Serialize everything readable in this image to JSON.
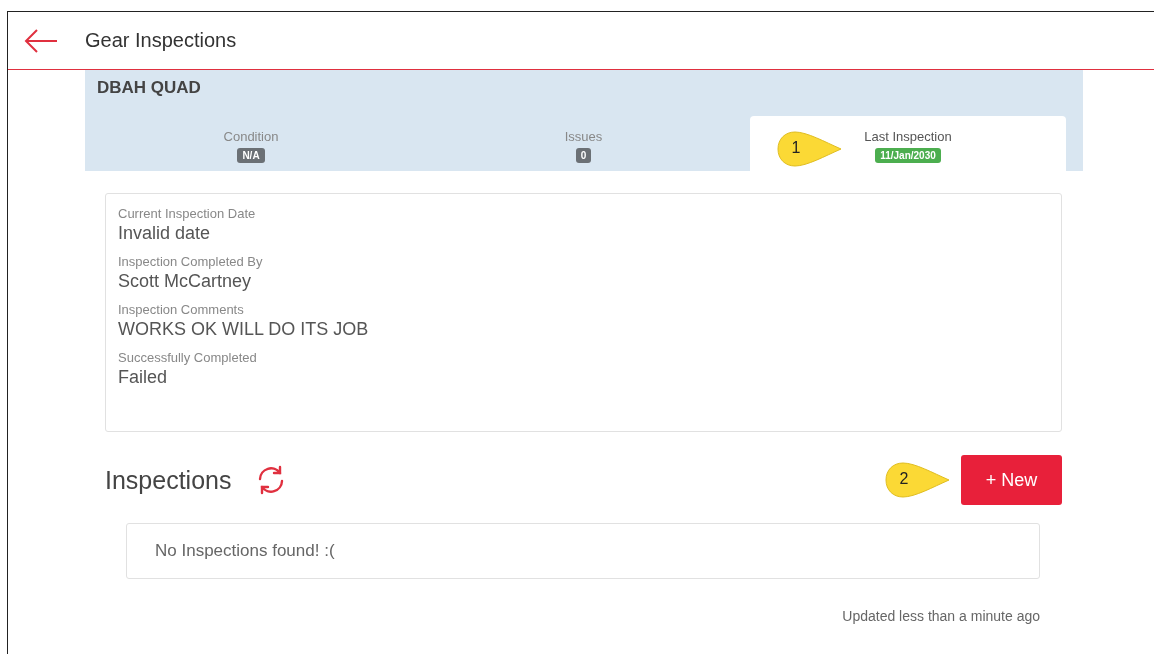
{
  "header": {
    "title": "Gear Inspections"
  },
  "asset": {
    "name": "DBAH QUAD",
    "tabs": [
      {
        "label": "Condition",
        "badge": "N/A",
        "color": "#6b7075",
        "selected": false
      },
      {
        "label": "Issues",
        "badge": "0",
        "color": "#6b7075",
        "selected": false
      },
      {
        "label": "Last Inspection",
        "badge": "11/Jan/2030",
        "color": "#4cae4f",
        "selected": true
      }
    ]
  },
  "details": [
    {
      "label": "Current Inspection Date",
      "value": "Invalid date"
    },
    {
      "label": "Inspection Completed By",
      "value": "Scott McCartney"
    },
    {
      "label": "Inspection Comments",
      "value": "WORKS OK WILL DO ITS JOB"
    },
    {
      "label": "Successfully Completed",
      "value": "Failed"
    }
  ],
  "callouts": [
    "1",
    "2"
  ],
  "inspections": {
    "title": "Inspections",
    "new_button": "+ New",
    "empty_message": "No Inspections found! :(",
    "updated": "Updated less than a minute ago"
  }
}
